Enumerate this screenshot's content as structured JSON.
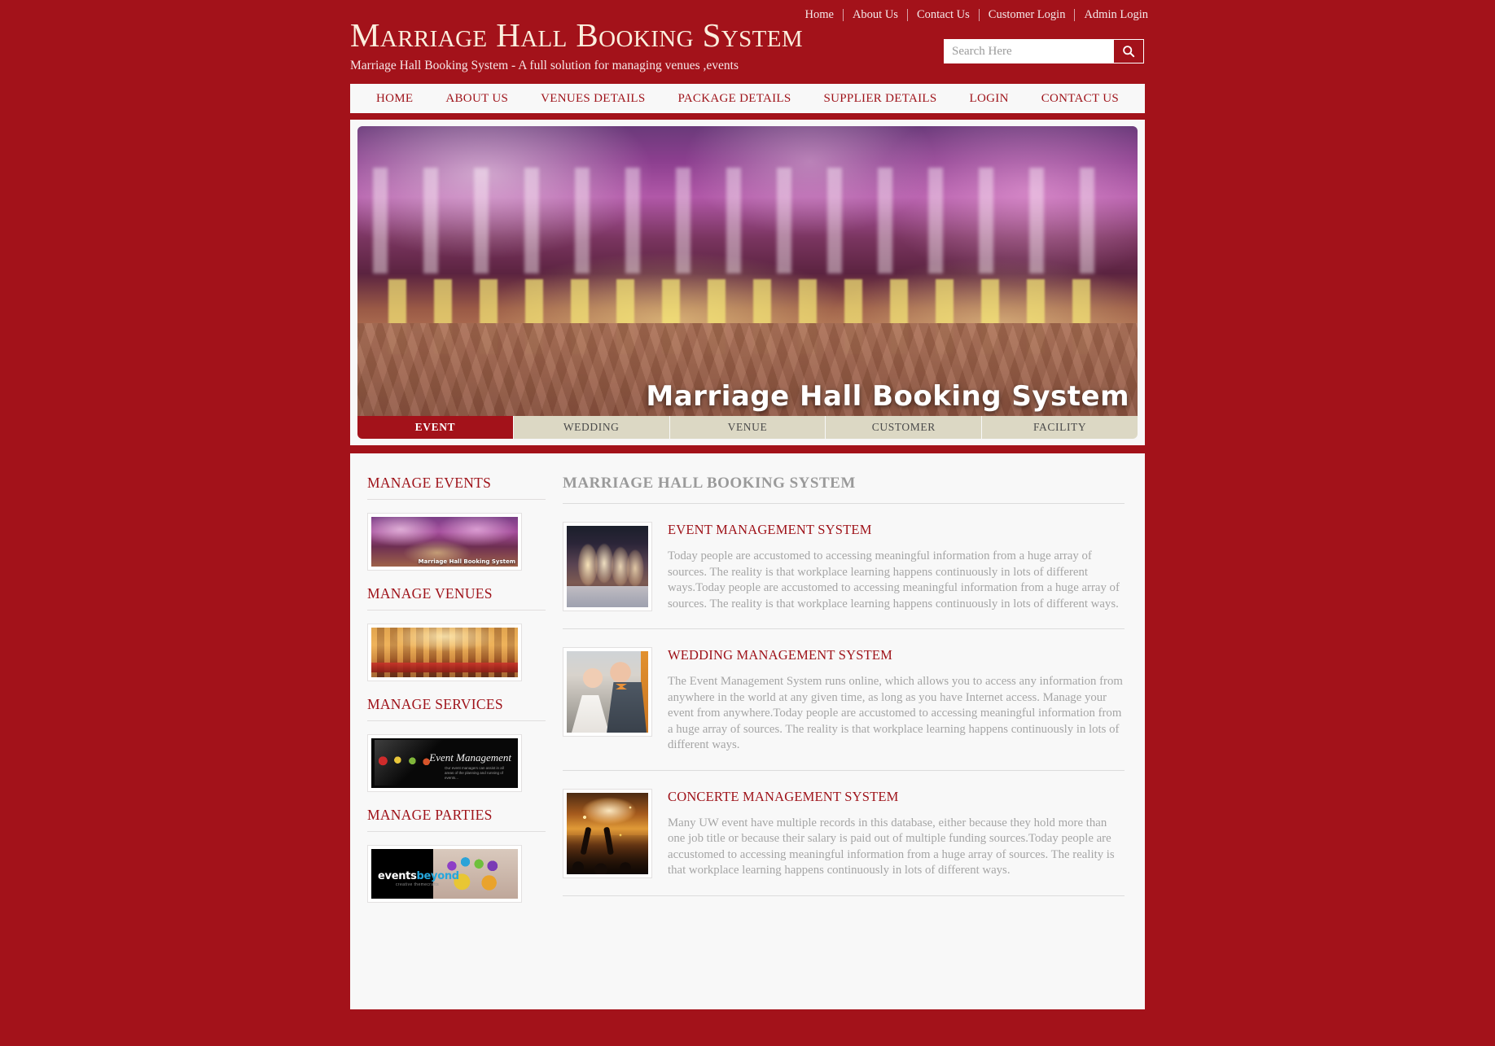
{
  "header": {
    "title": "Marriage Hall Booking System",
    "tagline": "Marriage Hall Booking System - A full solution for managing venues ,events",
    "top_links": [
      {
        "label": "Home"
      },
      {
        "label": "About Us"
      },
      {
        "label": "Contact Us"
      },
      {
        "label": "Customer Login"
      },
      {
        "label": "Admin Login"
      }
    ],
    "search": {
      "placeholder": "Search Here",
      "value": "",
      "icon": "search-icon"
    }
  },
  "nav": {
    "items": [
      {
        "label": "HOME"
      },
      {
        "label": "ABOUT US"
      },
      {
        "label": "VENUES DETAILS"
      },
      {
        "label": "PACKAGE DETAILS"
      },
      {
        "label": "SUPPLIER DETAILS"
      },
      {
        "label": "LOGIN"
      },
      {
        "label": "CONTACT US"
      }
    ]
  },
  "banner": {
    "caption": "Marriage Hall Booking System",
    "tabs": [
      {
        "label": "EVENT",
        "active": true
      },
      {
        "label": "WEDDING",
        "active": false
      },
      {
        "label": "VENUE",
        "active": false
      },
      {
        "label": "CUSTOMER",
        "active": false
      },
      {
        "label": "FACILITY",
        "active": false
      }
    ]
  },
  "sidebar": {
    "blocks": [
      {
        "title": "MANAGE EVENTS",
        "image_caption": "Marriage Hall Booking System"
      },
      {
        "title": "MANAGE VENUES",
        "image_caption": ""
      },
      {
        "title": "MANAGE SERVICES",
        "image_caption": "Event Management",
        "image_sub": "Our event managers can assist in all areas of the planning and running of events..."
      },
      {
        "title": "MANAGE PARTIES",
        "image_caption": "events",
        "image_caption2": "beyond",
        "image_sub": "creative themecrafts"
      }
    ]
  },
  "main": {
    "title": "MARRIAGE HALL BOOKING SYSTEM",
    "articles": [
      {
        "title": "EVENT MANAGEMENT SYSTEM",
        "text": "Today people are accustomed to accessing meaningful information from a huge array of sources. The reality is that workplace learning happens continuously in lots of different ways.Today people are accustomed to accessing meaningful information from a huge array of sources. The reality is that workplace learning happens continuously in lots of different ways."
      },
      {
        "title": "WEDDING MANAGEMENT SYSTEM",
        "text": "The Event Management System runs online, which allows you to access any information from anywhere in the world at any given time, as long as you have Internet access. Manage your event from anywhere.Today people are accustomed to accessing meaningful information from a huge array of sources. The reality is that workplace learning happens continuously in lots of different ways."
      },
      {
        "title": "CONCERTE MANAGEMENT SYSTEM",
        "text": "Many UW event have multiple records in this database, either because they hold more than one job title or because their salary is paid out of multiple funding sources.Today people are accustomed to accessing meaningful information from a huge array of sources. The reality is that workplace learning happens continuously in lots of different ways."
      }
    ]
  },
  "colors": {
    "brand_red": "#a3121a",
    "link_red": "#9e1118",
    "panel_bg": "#f8f8f8",
    "tab_inactive": "#dcd8c4",
    "body_text": "#a5a5a5"
  }
}
